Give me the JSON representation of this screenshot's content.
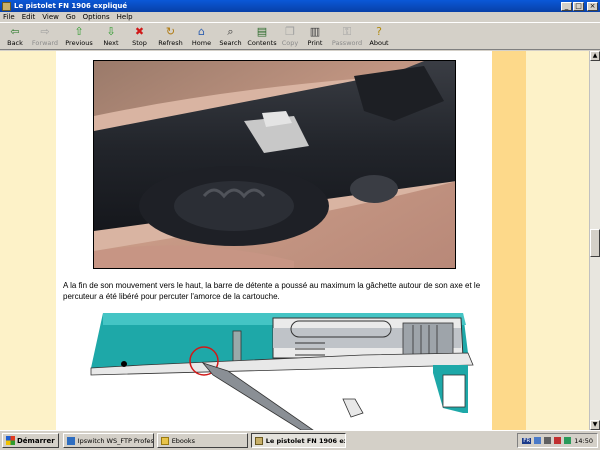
{
  "window": {
    "title": "Le pistolet FN 1906 expliqué",
    "min": "_",
    "max": "□",
    "close": "×"
  },
  "menu": [
    "File",
    "Edit",
    "View",
    "Go",
    "Options",
    "Help"
  ],
  "toolbar": [
    {
      "label": "Back",
      "icon": "⇦",
      "color": "#2a7a2a",
      "enabled": true
    },
    {
      "label": "Forward",
      "icon": "⇨",
      "color": "#a0a0a0",
      "enabled": false
    },
    {
      "label": "Previous",
      "icon": "⇧",
      "color": "#2a9a2a",
      "enabled": true
    },
    {
      "label": "Next",
      "icon": "⇩",
      "color": "#2a9a2a",
      "enabled": true
    },
    {
      "label": "Stop",
      "icon": "✖",
      "color": "#d01818",
      "enabled": true
    },
    {
      "label": "Refresh",
      "icon": "↻",
      "color": "#b07a10",
      "enabled": true
    },
    {
      "label": "Home",
      "icon": "⌂",
      "color": "#3060b0",
      "enabled": true
    },
    {
      "label": "Search",
      "icon": "⌕",
      "color": "#3a3a3a",
      "enabled": true
    },
    {
      "label": "Contents",
      "icon": "▤",
      "color": "#2a6a2a",
      "enabled": true
    },
    {
      "label": "Copy",
      "icon": "❐",
      "color": "#a0a0a0",
      "enabled": false
    },
    {
      "label": "Print",
      "icon": "▥",
      "color": "#404040",
      "enabled": true
    },
    {
      "label": "Password",
      "icon": "⚿",
      "color": "#a0a0a0",
      "enabled": false
    },
    {
      "label": "About",
      "icon": "?",
      "color": "#b08a10",
      "enabled": true
    }
  ],
  "page": {
    "caption": "A la fin de son mouvement vers le haut, la barre de détente a poussé au maximum la gâchette autour de son axe et le percuteur a été libéré pour percuter l'amorce de la cartouche."
  },
  "taskbar": {
    "start_label": "Démarrer",
    "tasks": [
      {
        "label": "Ipswitch WS_FTP Profes...",
        "active": false
      },
      {
        "label": "Ebooks",
        "active": false
      },
      {
        "label": "Le pistolet FN 1906 ex...",
        "active": true
      }
    ],
    "lang": "FR",
    "clock": "14:50"
  }
}
